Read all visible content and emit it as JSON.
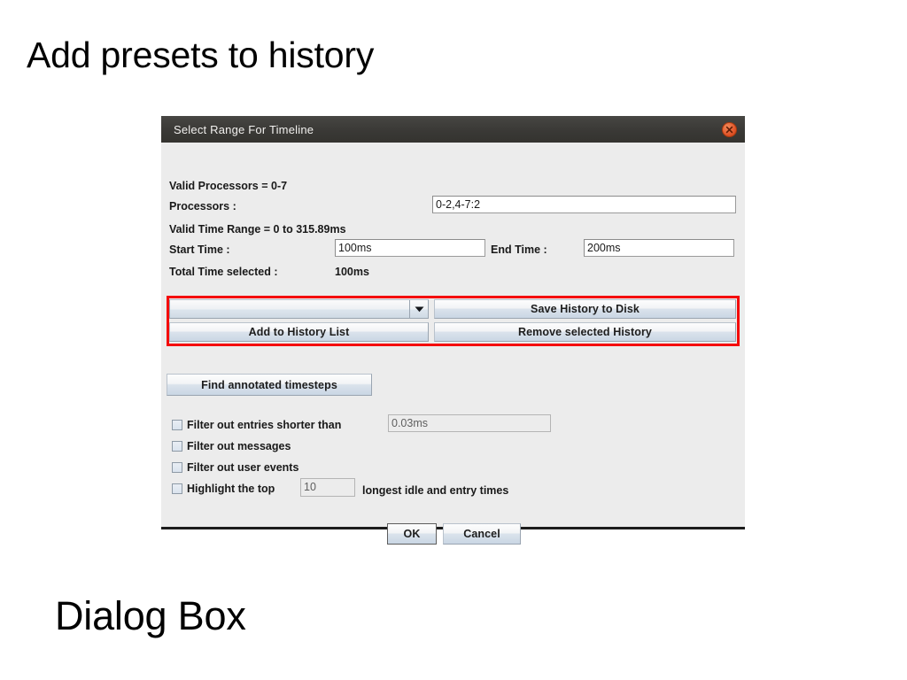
{
  "slide": {
    "title": "Add presets to history",
    "caption": "Dialog Box"
  },
  "dialog": {
    "titlebar": {
      "title": "Select Range For Timeline",
      "close_icon": "close-circle-icon",
      "close_color": "#e2562a",
      "background_color": "#3a3936"
    },
    "valid_processors_label": "Valid Processors = 0-7",
    "processors_label": "Processors :",
    "processors_value": "0-2,4-7:2",
    "valid_time_range_label": "Valid Time Range = 0 to 315.89ms",
    "start_time_label": "Start Time :",
    "start_time_value": "100ms",
    "end_time_label": "End Time :",
    "end_time_value": "200ms",
    "total_time_label": "Total Time selected :",
    "total_time_value": "100ms",
    "history": {
      "highlight_color": "#f40b0b",
      "preset_combo_value": "",
      "preset_combo_icon": "chevron-down-icon",
      "save_history_label": "Save History to Disk",
      "add_history_label": "Add to History List",
      "remove_history_label": "Remove selected History"
    },
    "find_timesteps_label": "Find annotated timesteps",
    "filters": [
      {
        "label": "Filter out entries shorter than",
        "checked": false,
        "value": "0.03ms",
        "has_field": true
      },
      {
        "label": "Filter out messages",
        "checked": false,
        "has_field": false
      },
      {
        "label": "Filter out user events",
        "checked": false,
        "has_field": false
      },
      {
        "label": "Highlight the top",
        "checked": false,
        "value": "10",
        "suffix": "longest idle and entry times",
        "has_field": true
      }
    ],
    "ok_label": "OK",
    "cancel_label": "Cancel"
  }
}
